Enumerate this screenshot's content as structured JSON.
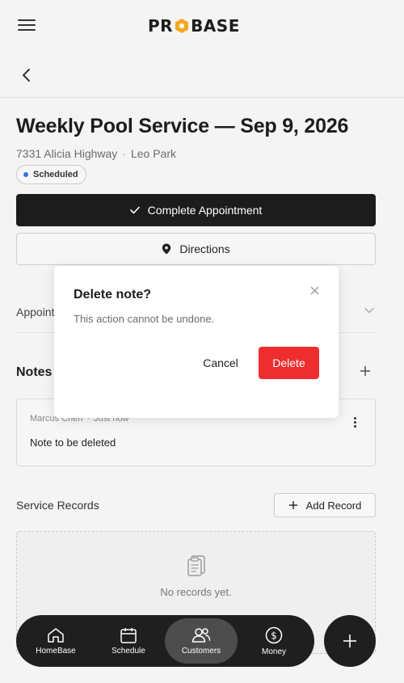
{
  "header": {
    "logo_text": "PROBASE"
  },
  "appointment": {
    "title": "Weekly Pool Service — Sep 9, 2026",
    "address": "7331 Alicia Highway",
    "customer": "Leo Park",
    "separator": "·",
    "status": "Scheduled"
  },
  "actions": {
    "complete_label": "Complete Appointment",
    "directions_label": "Directions"
  },
  "sections": {
    "appointment_details_label": "Appointment Details",
    "notes_label": "Notes",
    "service_records_label": "Service Records",
    "add_record_label": "Add Record",
    "empty_records_text": "No records yet."
  },
  "note": {
    "author": "Marcus Chen",
    "time": "Just now",
    "text": "Note to be deleted"
  },
  "bottom_nav": {
    "items": [
      {
        "label": "HomeBase",
        "icon": "home-icon"
      },
      {
        "label": "Schedule",
        "icon": "calendar-icon"
      },
      {
        "label": "Customers",
        "icon": "users-icon",
        "active": true
      },
      {
        "label": "Money",
        "icon": "dollar-icon"
      }
    ],
    "fab_icon": "plus-icon"
  },
  "dialog": {
    "title": "Delete note?",
    "message": "This action cannot be undone.",
    "cancel_label": "Cancel",
    "delete_label": "Delete"
  },
  "colors": {
    "accent_logo": "#f2a81d",
    "status_dot": "#2f6fe4",
    "danger": "#ee2e2e",
    "dark": "#1f1f1f"
  }
}
